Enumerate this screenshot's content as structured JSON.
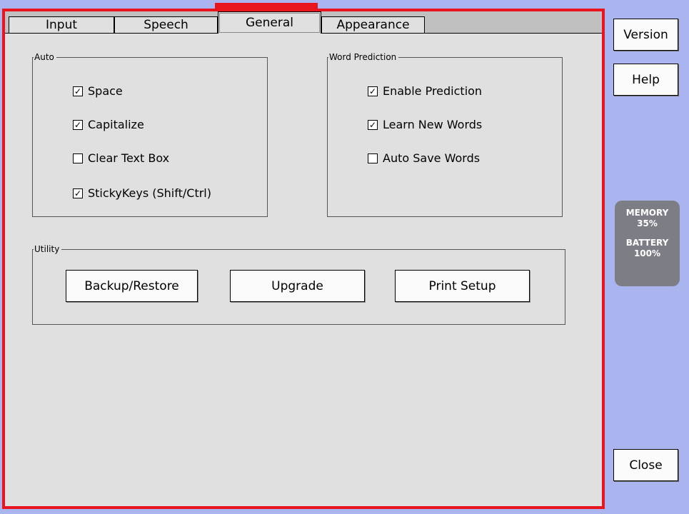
{
  "tabs": [
    {
      "label": "Input"
    },
    {
      "label": "Speech"
    },
    {
      "label": "General",
      "active": true
    },
    {
      "label": "Appearance"
    }
  ],
  "auto": {
    "title": "Auto",
    "items": [
      {
        "label": "Space",
        "checked": true
      },
      {
        "label": "Capitalize",
        "checked": true
      },
      {
        "label": "Clear Text Box",
        "checked": false
      },
      {
        "label": "StickyKeys (Shift/Ctrl)",
        "checked": true
      }
    ]
  },
  "word_prediction": {
    "title": "Word Prediction",
    "items": [
      {
        "label": "Enable Prediction",
        "checked": true
      },
      {
        "label": "Learn New Words",
        "checked": true
      },
      {
        "label": "Auto Save Words",
        "checked": false
      }
    ]
  },
  "utility": {
    "title": "Utility",
    "buttons": [
      {
        "label": "Backup/Restore"
      },
      {
        "label": "Upgrade"
      },
      {
        "label": "Print Setup"
      }
    ]
  },
  "side": {
    "version_label": "Version",
    "help_label": "Help",
    "close_label": "Close"
  },
  "status": {
    "memory_label": "MEMORY",
    "memory_value": "35%",
    "battery_label": "BATTERY",
    "battery_value": "100%"
  },
  "colors": {
    "accent": "#e8141e",
    "background": "#aab4ef",
    "panel": "#e0e0e0",
    "status_bg": "#7d7d86"
  }
}
